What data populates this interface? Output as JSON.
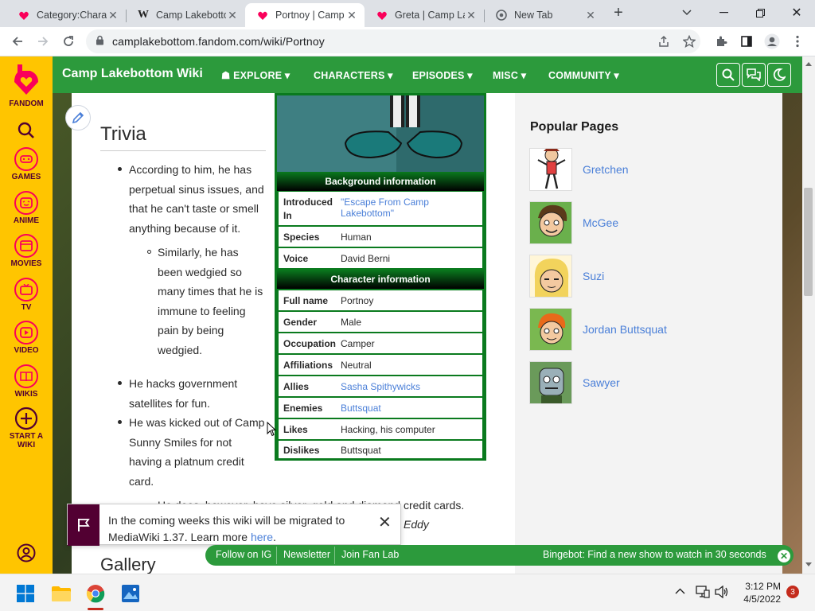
{
  "browser": {
    "tabs": [
      {
        "title": "Category:Chara",
        "icon": "fandom-icon"
      },
      {
        "title": "Camp Lakebottom",
        "icon": "wikipedia-icon"
      },
      {
        "title": "Portnoy | Camp",
        "icon": "fandom-icon",
        "active": true
      },
      {
        "title": "Greta | Camp La",
        "icon": "fandom-icon"
      },
      {
        "title": "New Tab",
        "icon": "chrome-icon"
      }
    ],
    "url": "camplakebottom.fandom.com/wiki/Portnoy"
  },
  "rail": {
    "brand": "FANDOM",
    "items": [
      {
        "label": "GAMES",
        "icon": "games-icon"
      },
      {
        "label": "ANIME",
        "icon": "anime-icon"
      },
      {
        "label": "MOVIES",
        "icon": "movies-icon"
      },
      {
        "label": "TV",
        "icon": "tv-icon"
      },
      {
        "label": "VIDEO",
        "icon": "video-icon"
      },
      {
        "label": "WIKIS",
        "icon": "wikis-icon"
      }
    ],
    "start_line1": "START A",
    "start_line2": "WIKI"
  },
  "wiki_header": {
    "name": "Camp Lakebottom Wiki",
    "nav": [
      "EXPLORE",
      "CHARACTERS",
      "EPISODES",
      "MISC",
      "COMMUNITY"
    ]
  },
  "trivia": {
    "heading": "Trivia",
    "item1_lines": [
      "According to him, he has",
      "perpetual sinus issues, and",
      "that he can't taste or smell",
      "anything because of it."
    ],
    "sub1_lines": [
      "Similarly, he has",
      "been wedgied so",
      "many times that he is",
      "immune to feeling",
      "pain by being",
      "wedgied."
    ],
    "item2_lines": [
      "He hacks government",
      "satellites for fun."
    ],
    "item3_lines": [
      "He was kicked out of Camp",
      "Sunny Smiles for not",
      "having a platnum credit",
      "card."
    ],
    "partial1": "He does, however, have silver, gold and diamond credit cards.",
    "partial2": "Eddy"
  },
  "infobox": {
    "section1": "Background information",
    "introduced_label": "Introduced",
    "introduced_label2": "In",
    "introduced_value": "\"Escape From Camp Lakebottom\"",
    "rows1": [
      {
        "label": "Species",
        "value": "Human"
      },
      {
        "label": "Voice",
        "value": "David Berni"
      }
    ],
    "section2": "Character information",
    "rows2": [
      {
        "label": "Full name",
        "value": "Portnoy"
      },
      {
        "label": "Gender",
        "value": "Male"
      },
      {
        "label": "Occupation",
        "value": "Camper"
      },
      {
        "label": "Affiliations",
        "value": "Neutral"
      },
      {
        "label": "Allies",
        "value": "Sasha Spithywicks"
      },
      {
        "label": "Enemies",
        "value": "Buttsquat"
      },
      {
        "label": "Likes",
        "value": "Hacking, his computer"
      },
      {
        "label": "Dislikes",
        "value": "Buttsquat"
      }
    ]
  },
  "popular": {
    "heading": "Popular Pages",
    "items": [
      "Gretchen",
      "McGee",
      "Suzi",
      "Jordan Buttsquat",
      "Sawyer"
    ]
  },
  "gallery_heading": "Gallery",
  "notification": {
    "line1": "In the coming weeks this wiki will be migrated to",
    "line2_prefix": "MediaWiki 1.37. Learn more ",
    "link": "here",
    "suffix": "."
  },
  "fan_bar": {
    "follow": "Follow on IG",
    "newsletter": "Newsletter",
    "fanlab": "Join Fan Lab",
    "bingebot": "Bingebot: Find a new show to watch in 30 seconds"
  },
  "taskbar": {
    "time": "3:12 PM",
    "date": "4/5/2022",
    "badge": "3"
  },
  "colors": {
    "wiki_green": "#2c9a3c",
    "fandom_yellow": "#ffc500",
    "fandom_pink": "#fa005a",
    "link_blue": "#4a7fd8"
  }
}
